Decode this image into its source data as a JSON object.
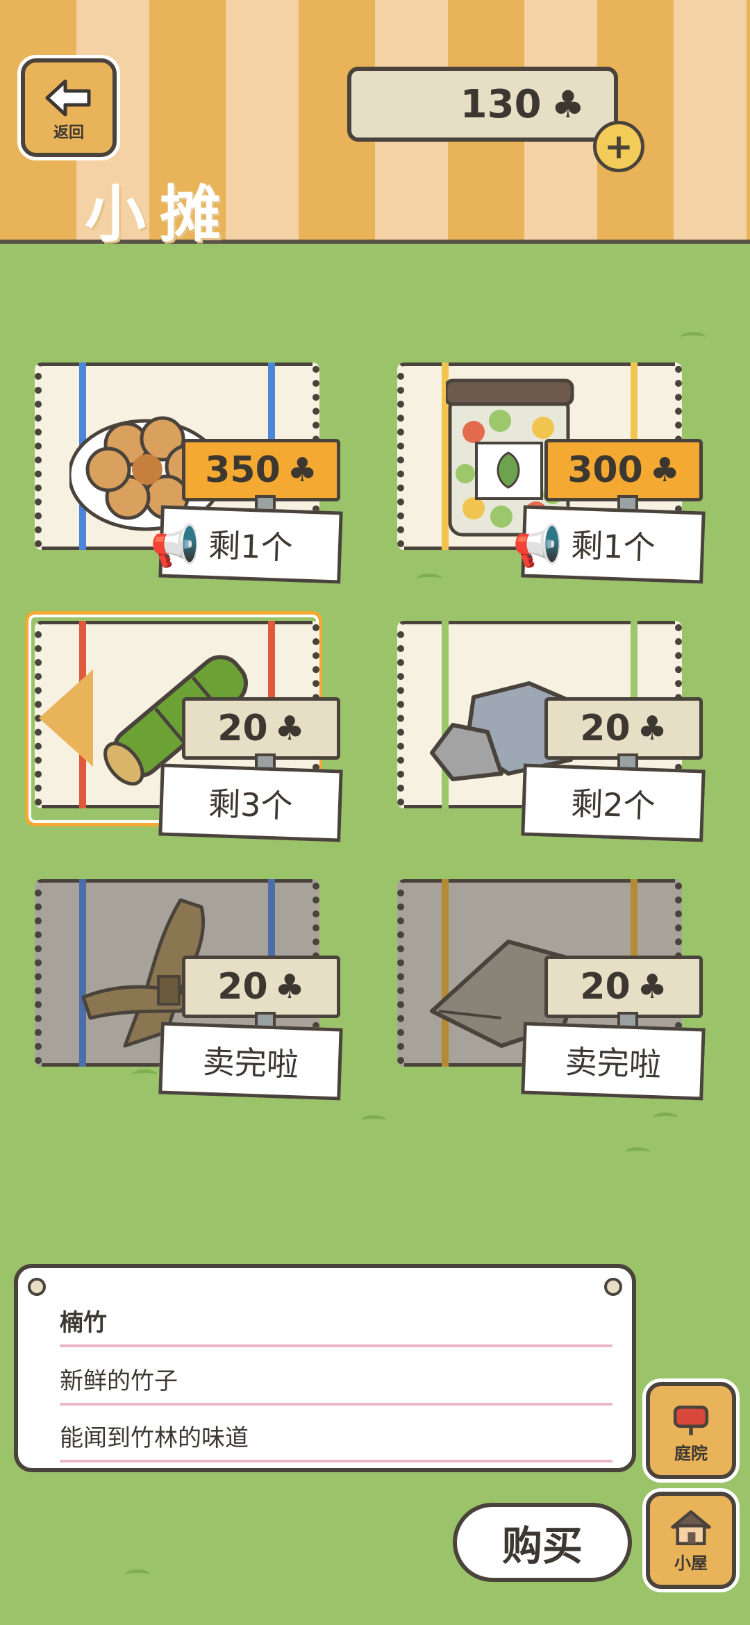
{
  "header": {
    "back_label": "返回",
    "title": "小摊",
    "coins": "130",
    "clover_symbol": "♣",
    "plus_symbol": "+"
  },
  "items": [
    {
      "name": "pretzel-cookie",
      "price": "350",
      "stock": "剩1个",
      "tag_color": "#f3a932",
      "stripe_color": "#4b86d8",
      "has_horn": true,
      "selected": false,
      "sold_out": false
    },
    {
      "name": "leaf-candy-jar",
      "price": "300",
      "stock": "剩1个",
      "tag_color": "#f3a932",
      "stripe_color": "#f1c44f",
      "has_horn": true,
      "selected": false,
      "sold_out": false
    },
    {
      "name": "bamboo",
      "price": "20",
      "stock": "剩3个",
      "tag_color": "#e6dfc6",
      "stripe_color": "#e0593c",
      "has_horn": false,
      "selected": true,
      "sold_out": false
    },
    {
      "name": "stones",
      "price": "20",
      "stock": "剩2个",
      "tag_color": "#e6dfc6",
      "stripe_color": "#9cc76b",
      "has_horn": false,
      "selected": false,
      "sold_out": false
    },
    {
      "name": "firewood-bundle",
      "price": "20",
      "stock": "卖完啦",
      "tag_color": "#e6dfc6",
      "stripe_color": "#4b86d8",
      "has_horn": false,
      "selected": false,
      "sold_out": true
    },
    {
      "name": "cloth-sack",
      "price": "20",
      "stock": "卖完啦",
      "tag_color": "#e6dfc6",
      "stripe_color": "#c99a3f",
      "has_horn": false,
      "selected": false,
      "sold_out": true
    }
  ],
  "description": {
    "title": "楠竹",
    "line1": "新鲜的竹子",
    "line2": "能闻到竹林的味道"
  },
  "buttons": {
    "yard_label": "庭院",
    "house_label": "小屋",
    "buy_label": "购买"
  },
  "colors": {
    "grass": "#9bc46a",
    "wood": "#e9b35a",
    "outline": "#4a433c",
    "accent_orange": "#f3a932"
  }
}
